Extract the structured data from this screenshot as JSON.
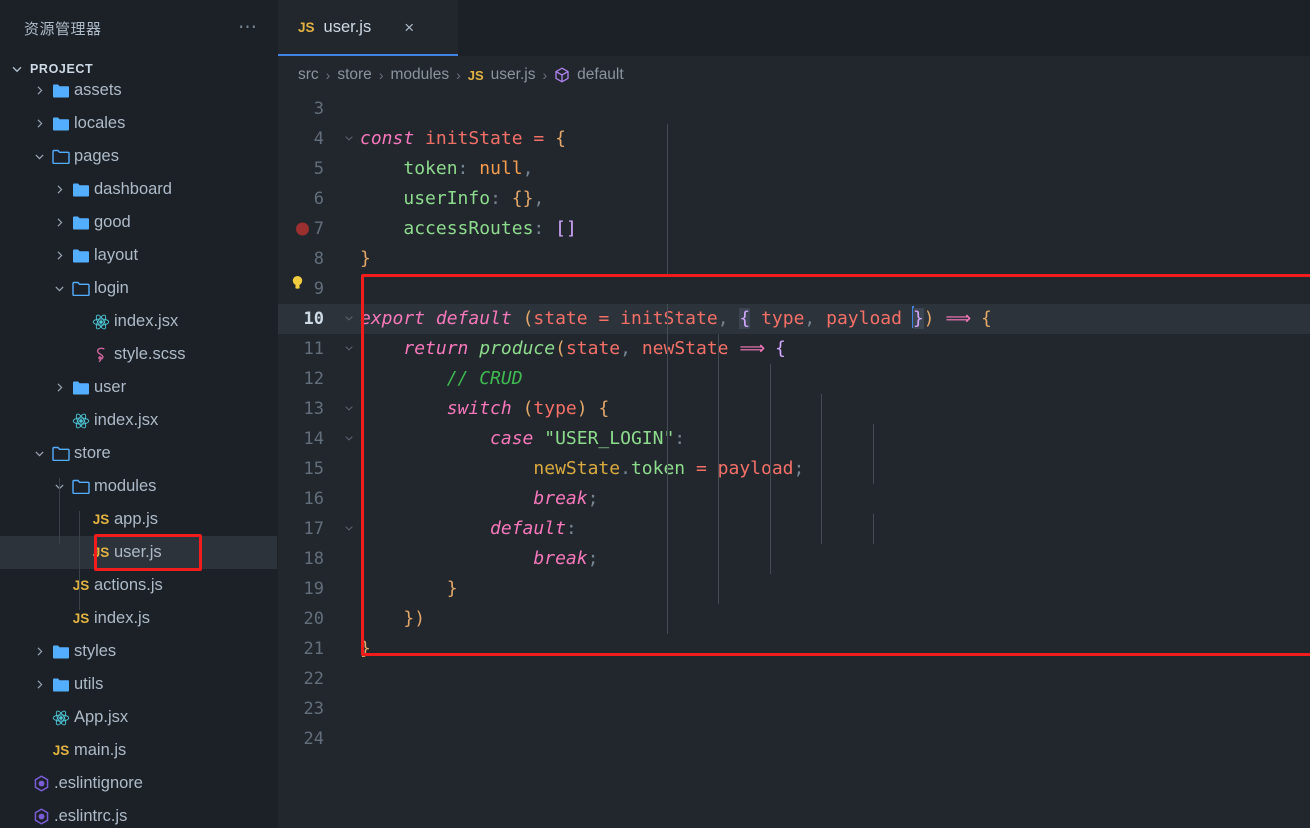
{
  "sidebar": {
    "title": "资源管理器",
    "more_icon": "ellipsis-icon",
    "section": {
      "label": "PROJECT",
      "expanded": true
    },
    "items": [
      {
        "label": "assets",
        "type": "folder",
        "depth": 1,
        "arrow": "›",
        "clipped": true
      },
      {
        "label": "locales",
        "type": "folder",
        "depth": 1,
        "arrow": "›"
      },
      {
        "label": "pages",
        "type": "folder-open",
        "depth": 1,
        "arrow": "∨"
      },
      {
        "label": "dashboard",
        "type": "folder",
        "depth": 2,
        "arrow": "›"
      },
      {
        "label": "good",
        "type": "folder",
        "depth": 2,
        "arrow": "›"
      },
      {
        "label": "layout",
        "type": "folder",
        "depth": 2,
        "arrow": "›"
      },
      {
        "label": "login",
        "type": "folder-open",
        "depth": 2,
        "arrow": "∨"
      },
      {
        "label": "index.jsx",
        "type": "react",
        "depth": 3,
        "arrow": ""
      },
      {
        "label": "style.scss",
        "type": "sass",
        "depth": 3,
        "arrow": ""
      },
      {
        "label": "user",
        "type": "folder",
        "depth": 2,
        "arrow": "›"
      },
      {
        "label": "index.jsx",
        "type": "react",
        "depth": 2,
        "arrow": ""
      },
      {
        "label": "store",
        "type": "folder-open",
        "depth": 1,
        "arrow": "∨"
      },
      {
        "label": "modules",
        "type": "folder-open",
        "depth": 2,
        "arrow": "∨"
      },
      {
        "label": "app.js",
        "type": "js",
        "depth": 3,
        "arrow": ""
      },
      {
        "label": "user.js",
        "type": "js",
        "depth": 3,
        "arrow": "",
        "selected": true,
        "annotated": true
      },
      {
        "label": "actions.js",
        "type": "js",
        "depth": 2,
        "arrow": ""
      },
      {
        "label": "index.js",
        "type": "js",
        "depth": 2,
        "arrow": ""
      },
      {
        "label": "styles",
        "type": "folder",
        "depth": 1,
        "arrow": "›"
      },
      {
        "label": "utils",
        "type": "folder",
        "depth": 1,
        "arrow": "›"
      },
      {
        "label": "App.jsx",
        "type": "react",
        "depth": 1,
        "arrow": ""
      },
      {
        "label": "main.js",
        "type": "js",
        "depth": 1,
        "arrow": ""
      },
      {
        "label": ".eslintignore",
        "type": "eslint",
        "depth": 0,
        "arrow": ""
      },
      {
        "label": ".eslintrc.js",
        "type": "eslint",
        "depth": 0,
        "arrow": ""
      }
    ]
  },
  "tabs": [
    {
      "label": "user.js",
      "icon": "js-icon",
      "active": true,
      "close_icon": "×"
    }
  ],
  "breadcrumb": {
    "separator": "›",
    "crumbs": [
      {
        "label": "src",
        "icon": ""
      },
      {
        "label": "store",
        "icon": ""
      },
      {
        "label": "modules",
        "icon": ""
      },
      {
        "label": "user.js",
        "icon": "js-icon"
      },
      {
        "label": "default",
        "icon": "symbol-cube-icon"
      }
    ]
  },
  "editor": {
    "first_visible_line": 3,
    "last_visible_line": 24,
    "active_line": 10,
    "breakpoint_line": 7,
    "lightbulb_line": 9,
    "code_lines": [
      {
        "n": 3,
        "text": ""
      },
      {
        "n": 4,
        "text": "const initState = {"
      },
      {
        "n": 5,
        "text": "    token: null,"
      },
      {
        "n": 6,
        "text": "    userInfo: {},"
      },
      {
        "n": 7,
        "text": "    accessRoutes: []"
      },
      {
        "n": 8,
        "text": "}"
      },
      {
        "n": 9,
        "text": ""
      },
      {
        "n": 10,
        "text": "export default (state = initState, { type, payload }) => {"
      },
      {
        "n": 11,
        "text": "    return produce(state, newState => {"
      },
      {
        "n": 12,
        "text": "        // CRUD"
      },
      {
        "n": 13,
        "text": "        switch (type) {"
      },
      {
        "n": 14,
        "text": "            case \"USER_LOGIN\":"
      },
      {
        "n": 15,
        "text": "                newState.token = payload;"
      },
      {
        "n": 16,
        "text": "                break;"
      },
      {
        "n": 17,
        "text": "            default:"
      },
      {
        "n": 18,
        "text": "                break;"
      },
      {
        "n": 19,
        "text": "        }"
      },
      {
        "n": 20,
        "text": "    })"
      },
      {
        "n": 21,
        "text": "}"
      },
      {
        "n": 22,
        "text": ""
      },
      {
        "n": 23,
        "text": ""
      },
      {
        "n": 24,
        "text": ""
      }
    ]
  },
  "annotations": {
    "color": "#f21c1c",
    "sidebar_box_target": "user.js",
    "code_box_lines": "10-21"
  },
  "colors": {
    "accent": "#4184e4",
    "editor_bg": "#22272e",
    "sidebar_bg": "#1c2128",
    "active_line": "#2d333b",
    "annotation": "#f21c1c",
    "breakpoint": "#9c2f2f",
    "lightbulb": "#f2cc3f"
  }
}
